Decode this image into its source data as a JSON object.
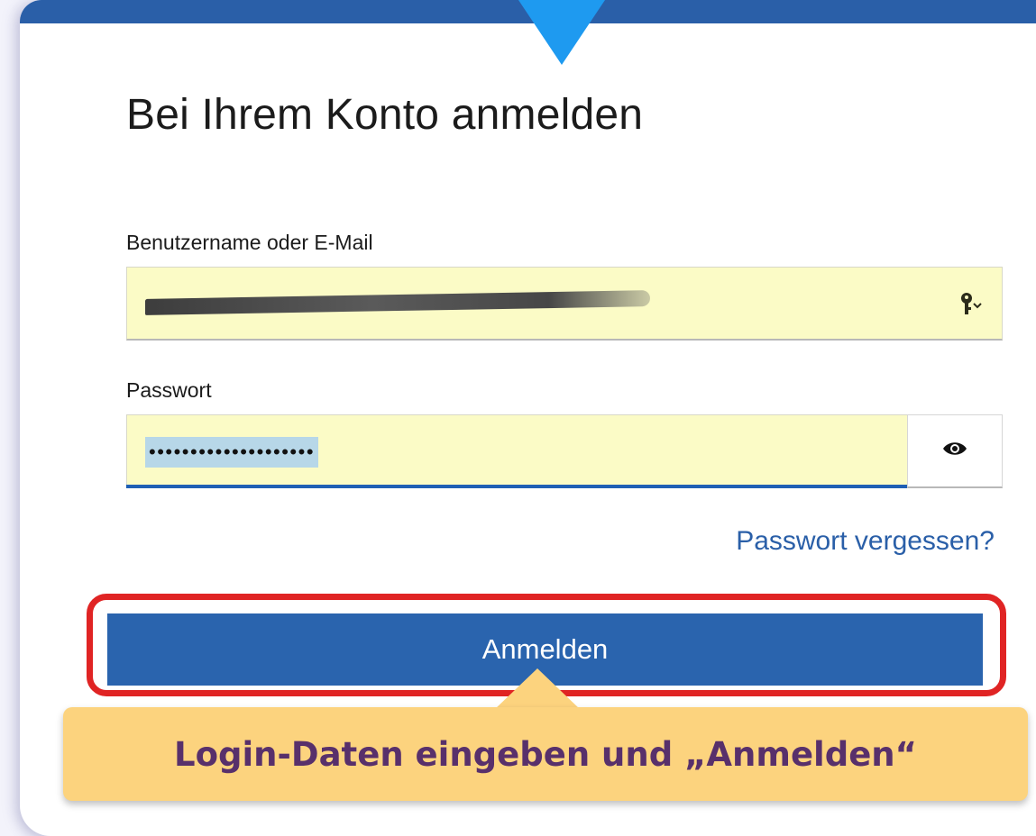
{
  "title": "Bei Ihrem Konto anmelden",
  "username": {
    "label": "Benutzername oder E-Mail",
    "value_redacted": true
  },
  "password": {
    "label": "Passwort",
    "value": "••••••••••••••••••••"
  },
  "forgot_link": "Passwort vergessen?",
  "submit_label": "Anmelden",
  "callout": "Login-Daten eingeben und „Anmelden“",
  "colors": {
    "brand_blue": "#2a64ae",
    "autofill_yellow": "#fbfbc6",
    "highlight_red": "#e02424",
    "callout_bg": "#fcd37e",
    "callout_text": "#58306b",
    "pointer_blue": "#1e9af0"
  },
  "icons": {
    "username_field": "key-icon",
    "password_toggle": "eye-icon"
  }
}
